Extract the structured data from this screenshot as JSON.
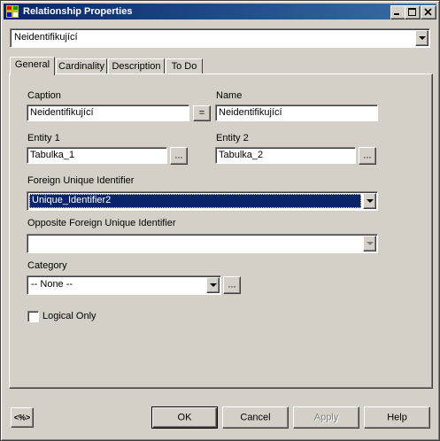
{
  "window": {
    "title": "Relationship Properties"
  },
  "top_selector": {
    "value": "Neidentifikující"
  },
  "tabs": [
    {
      "label": "General",
      "active": true
    },
    {
      "label": "Cardinality",
      "active": false
    },
    {
      "label": "Description",
      "active": false
    },
    {
      "label": "To Do",
      "active": false
    }
  ],
  "general": {
    "caption": {
      "label": "Caption",
      "value": "Neidentifikující"
    },
    "equal_button": "=",
    "name": {
      "label": "Name",
      "value": "Neidentifikující"
    },
    "entity1": {
      "label": "Entity 1",
      "value": "Tabulka_1",
      "browse": "..."
    },
    "entity2": {
      "label": "Entity 2",
      "value": "Tabulka_2",
      "browse": "..."
    },
    "foreign_uid": {
      "label": "Foreign Unique Identifier",
      "value": "Unique_Identifier2"
    },
    "opposite_foreign_uid": {
      "label": "Opposite Foreign Unique Identifier",
      "value": ""
    },
    "category": {
      "label": "Category",
      "value": "-- None --",
      "browse": "..."
    },
    "logical_only": {
      "label": "Logical Only",
      "checked": false
    }
  },
  "footer": {
    "macro_button": "<%>",
    "ok": "OK",
    "cancel": "Cancel",
    "apply": "Apply",
    "help": "Help"
  },
  "colors": {
    "title_start": "#0a246a",
    "title_end": "#3a6ea5",
    "face": "#d4d0c8",
    "selection": "#0a246a"
  }
}
